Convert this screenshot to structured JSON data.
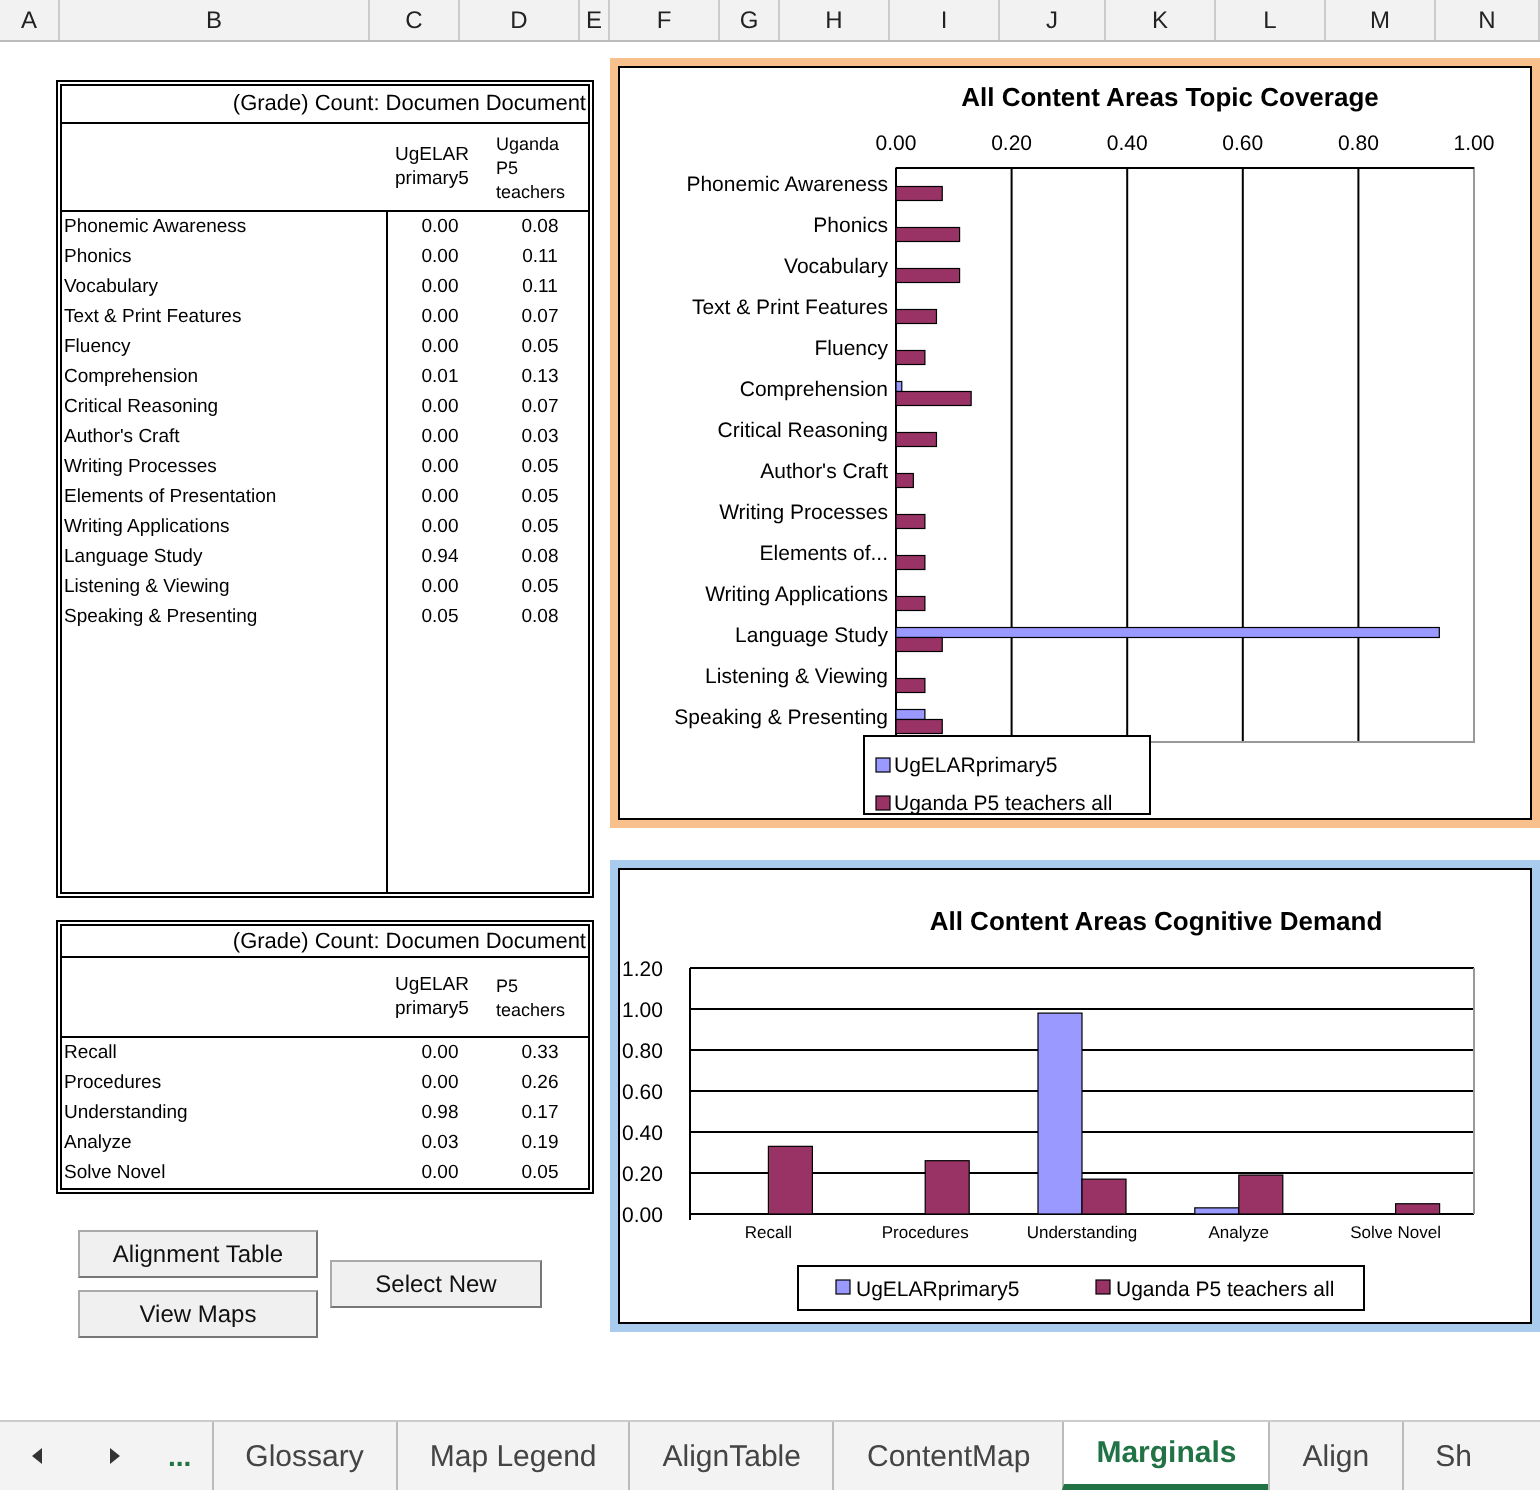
{
  "columns": [
    "A",
    "B",
    "C",
    "D",
    "E",
    "F",
    "G",
    "H",
    "I",
    "J",
    "K",
    "L",
    "M",
    "N"
  ],
  "topic_table": {
    "title": [
      "(Grade) Count:",
      "Documen",
      "Document"
    ],
    "headers": [
      "UgELARprimary5",
      "Uganda P5 teachers"
    ],
    "rows": [
      {
        "label": "Phonemic Awareness",
        "values": [
          "0.00",
          "0.08"
        ]
      },
      {
        "label": "Phonics",
        "values": [
          "0.00",
          "0.11"
        ]
      },
      {
        "label": "Vocabulary",
        "values": [
          "0.00",
          "0.11"
        ]
      },
      {
        "label": "Text & Print Features",
        "values": [
          "0.00",
          "0.07"
        ]
      },
      {
        "label": "Fluency",
        "values": [
          "0.00",
          "0.05"
        ]
      },
      {
        "label": "Comprehension",
        "values": [
          "0.01",
          "0.13"
        ]
      },
      {
        "label": "Critical Reasoning",
        "values": [
          "0.00",
          "0.07"
        ]
      },
      {
        "label": "Author's Craft",
        "values": [
          "0.00",
          "0.03"
        ]
      },
      {
        "label": "Writing Processes",
        "values": [
          "0.00",
          "0.05"
        ]
      },
      {
        "label": "Elements of Presentation",
        "values": [
          "0.00",
          "0.05"
        ]
      },
      {
        "label": "Writing Applications",
        "values": [
          "0.00",
          "0.05"
        ]
      },
      {
        "label": "Language Study",
        "values": [
          "0.94",
          "0.08"
        ]
      },
      {
        "label": "Listening & Viewing",
        "values": [
          "0.00",
          "0.05"
        ]
      },
      {
        "label": "Speaking & Presenting",
        "values": [
          "0.05",
          "0.08"
        ]
      }
    ]
  },
  "demand_table": {
    "title": [
      "(Grade) Count:",
      "Documen",
      "Document"
    ],
    "headers": [
      "UgELARprimary5",
      "P5 teachers"
    ],
    "rows": [
      {
        "label": "Recall",
        "values": [
          "0.00",
          "0.33"
        ]
      },
      {
        "label": "Procedures",
        "values": [
          "0.00",
          "0.26"
        ]
      },
      {
        "label": "Understanding",
        "values": [
          "0.98",
          "0.17"
        ]
      },
      {
        "label": "Analyze",
        "values": [
          "0.03",
          "0.19"
        ]
      },
      {
        "label": "Solve Novel",
        "values": [
          "0.00",
          "0.05"
        ]
      }
    ]
  },
  "buttons": [
    "Alignment Table",
    "View Maps",
    "Select New"
  ],
  "topic_chart": {
    "chart_data": {
      "type": "bar",
      "orientation": "horizontal",
      "title": "All Content Areas Topic Coverage",
      "categories": [
        "Phonemic Awareness",
        "Phonics",
        "Vocabulary",
        "Text & Print Features",
        "Fluency",
        "Comprehension",
        "Critical Reasoning",
        "Author's Craft",
        "Writing Processes",
        "Elements of...",
        "Writing Applications",
        "Language Study",
        "Listening & Viewing",
        "Speaking & Presenting"
      ],
      "series": [
        {
          "name": "UgELARprimary5",
          "color": "#9999ff",
          "values": [
            0,
            0,
            0,
            0,
            0,
            0.01,
            0,
            0,
            0,
            0,
            0,
            0.94,
            0,
            0.05
          ]
        },
        {
          "name": "Uganda P5 teachers all",
          "color": "#993366",
          "values": [
            0.08,
            0.11,
            0.11,
            0.07,
            0.05,
            0.13,
            0.07,
            0.03,
            0.05,
            0.05,
            0.05,
            0.08,
            0.05,
            0.08
          ]
        }
      ],
      "grid": true,
      "legend": true,
      "xlim": [
        0,
        1
      ],
      "xticks": [
        {
          "value": 0,
          "label": "0.00"
        },
        {
          "value": 0.2,
          "label": "0.20"
        },
        {
          "value": 0.4,
          "label": "0.40"
        },
        {
          "value": 0.6,
          "label": "0.60"
        },
        {
          "value": 0.8,
          "label": "0.80"
        },
        {
          "value": 1,
          "label": "1.00"
        }
      ]
    }
  },
  "demand_chart": {
    "chart_data": {
      "type": "bar",
      "title": "All Content Areas Cognitive Demand",
      "categories": [
        "Recall",
        "Procedures",
        "Understanding",
        "Analyze",
        "Solve Novel"
      ],
      "series": [
        {
          "name": "UgELARprimary5",
          "color": "#9999ff",
          "values": [
            0,
            0,
            0.98,
            0.03,
            0
          ]
        },
        {
          "name": "Uganda P5 teachers all",
          "color": "#993366",
          "values": [
            0.33,
            0.26,
            0.17,
            0.19,
            0.05
          ]
        }
      ],
      "grid": true,
      "legend": true,
      "ylim": [
        0,
        1.2
      ],
      "yticks": [
        {
          "value": 0,
          "label": "0.00"
        },
        {
          "value": 0.2,
          "label": "0.20"
        },
        {
          "value": 0.4,
          "label": "0.40"
        },
        {
          "value": 0.6,
          "label": "0.60"
        },
        {
          "value": 0.8,
          "label": "0.80"
        },
        {
          "value": 1,
          "label": "1.00"
        },
        {
          "value": 1.2,
          "label": "1.20"
        }
      ]
    }
  },
  "sheet_tabs": {
    "more": "...",
    "tabs": [
      {
        "label": "Glossary",
        "selected": false
      },
      {
        "label": "Map Legend",
        "selected": false
      },
      {
        "label": "AlignTable",
        "selected": false
      },
      {
        "label": "ContentMap",
        "selected": false
      },
      {
        "label": "Marginals",
        "selected": true
      },
      {
        "label": "Align",
        "selected": false
      },
      {
        "label": "Sh",
        "selected": false
      }
    ]
  }
}
